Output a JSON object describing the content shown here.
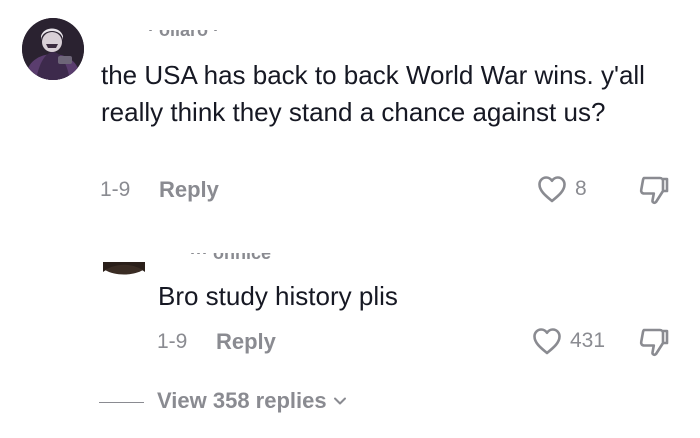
{
  "comments": [
    {
      "username": "· ollaro ·",
      "text": "the USA has back to back World War wins. y'all really think they stand a chance against us?",
      "date": "1-9",
      "reply_label": "Reply",
      "likes": "8"
    }
  ],
  "replies": [
    {
      "username": "··· ohnice",
      "text": "Bro study history plis",
      "date": "1-9",
      "reply_label": "Reply",
      "likes": "431"
    }
  ],
  "view_replies": {
    "label": "View 358 replies",
    "icon": "chevron-down-icon"
  },
  "colors": {
    "text": "#161823",
    "muted": "#8a8b91",
    "background": "#ffffff"
  },
  "icons": {
    "like": "heart-outline-icon",
    "dislike": "thumbs-down-outline-icon"
  }
}
